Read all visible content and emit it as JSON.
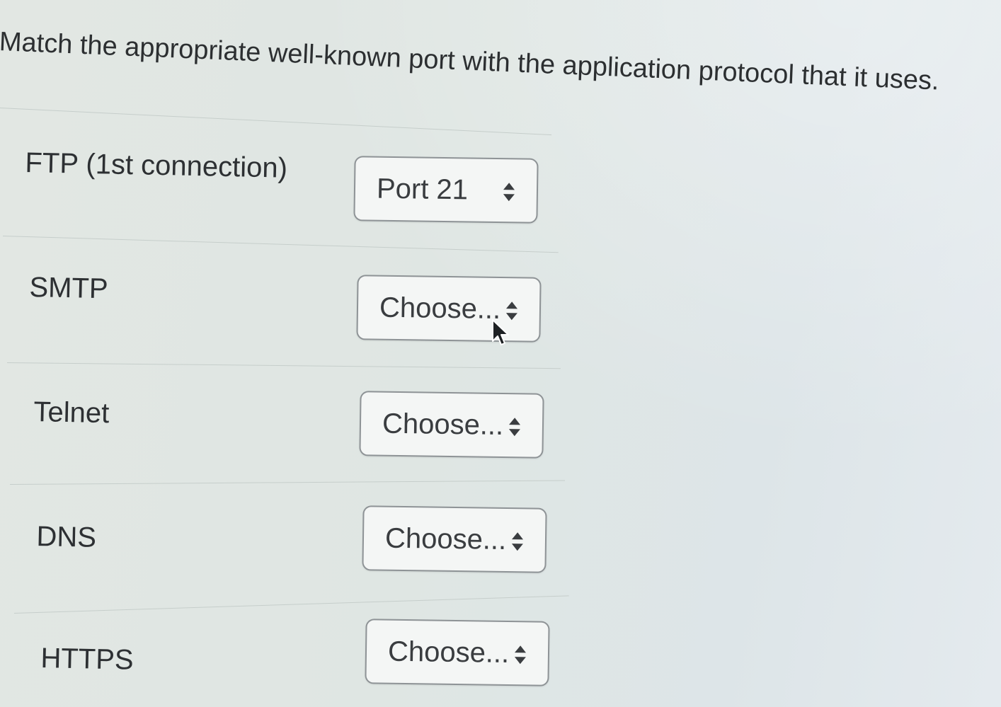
{
  "question": {
    "text": "Match the appropriate well-known port with the application protocol that it uses."
  },
  "rows": [
    {
      "label": "FTP (1st connection)",
      "selected": "Port 21"
    },
    {
      "label": "SMTP",
      "selected": "Choose..."
    },
    {
      "label": "Telnet",
      "selected": "Choose..."
    },
    {
      "label": "DNS",
      "selected": "Choose..."
    },
    {
      "label": "HTTPS",
      "selected": "Choose..."
    }
  ],
  "icons": {
    "select_arrows": "up-down-arrows-icon",
    "pointer": "mouse-cursor-icon"
  },
  "colors": {
    "background": "#dfe6e3",
    "select_border": "#8e9396",
    "text": "#2d3033"
  }
}
